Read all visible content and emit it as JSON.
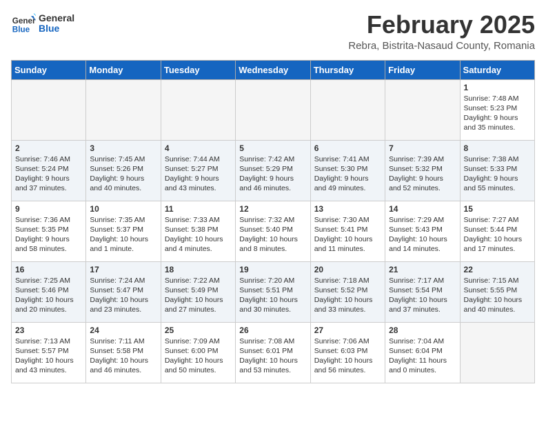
{
  "logo": {
    "text_general": "General",
    "text_blue": "Blue"
  },
  "header": {
    "month": "February 2025",
    "location": "Rebra, Bistrita-Nasaud County, Romania"
  },
  "weekdays": [
    "Sunday",
    "Monday",
    "Tuesday",
    "Wednesday",
    "Thursday",
    "Friday",
    "Saturday"
  ],
  "weeks": [
    [
      {
        "day": "",
        "info": ""
      },
      {
        "day": "",
        "info": ""
      },
      {
        "day": "",
        "info": ""
      },
      {
        "day": "",
        "info": ""
      },
      {
        "day": "",
        "info": ""
      },
      {
        "day": "",
        "info": ""
      },
      {
        "day": "1",
        "info": "Sunrise: 7:48 AM\nSunset: 5:23 PM\nDaylight: 9 hours and 35 minutes."
      }
    ],
    [
      {
        "day": "2",
        "info": "Sunrise: 7:46 AM\nSunset: 5:24 PM\nDaylight: 9 hours and 37 minutes."
      },
      {
        "day": "3",
        "info": "Sunrise: 7:45 AM\nSunset: 5:26 PM\nDaylight: 9 hours and 40 minutes."
      },
      {
        "day": "4",
        "info": "Sunrise: 7:44 AM\nSunset: 5:27 PM\nDaylight: 9 hours and 43 minutes."
      },
      {
        "day": "5",
        "info": "Sunrise: 7:42 AM\nSunset: 5:29 PM\nDaylight: 9 hours and 46 minutes."
      },
      {
        "day": "6",
        "info": "Sunrise: 7:41 AM\nSunset: 5:30 PM\nDaylight: 9 hours and 49 minutes."
      },
      {
        "day": "7",
        "info": "Sunrise: 7:39 AM\nSunset: 5:32 PM\nDaylight: 9 hours and 52 minutes."
      },
      {
        "day": "8",
        "info": "Sunrise: 7:38 AM\nSunset: 5:33 PM\nDaylight: 9 hours and 55 minutes."
      }
    ],
    [
      {
        "day": "9",
        "info": "Sunrise: 7:36 AM\nSunset: 5:35 PM\nDaylight: 9 hours and 58 minutes."
      },
      {
        "day": "10",
        "info": "Sunrise: 7:35 AM\nSunset: 5:37 PM\nDaylight: 10 hours and 1 minute."
      },
      {
        "day": "11",
        "info": "Sunrise: 7:33 AM\nSunset: 5:38 PM\nDaylight: 10 hours and 4 minutes."
      },
      {
        "day": "12",
        "info": "Sunrise: 7:32 AM\nSunset: 5:40 PM\nDaylight: 10 hours and 8 minutes."
      },
      {
        "day": "13",
        "info": "Sunrise: 7:30 AM\nSunset: 5:41 PM\nDaylight: 10 hours and 11 minutes."
      },
      {
        "day": "14",
        "info": "Sunrise: 7:29 AM\nSunset: 5:43 PM\nDaylight: 10 hours and 14 minutes."
      },
      {
        "day": "15",
        "info": "Sunrise: 7:27 AM\nSunset: 5:44 PM\nDaylight: 10 hours and 17 minutes."
      }
    ],
    [
      {
        "day": "16",
        "info": "Sunrise: 7:25 AM\nSunset: 5:46 PM\nDaylight: 10 hours and 20 minutes."
      },
      {
        "day": "17",
        "info": "Sunrise: 7:24 AM\nSunset: 5:47 PM\nDaylight: 10 hours and 23 minutes."
      },
      {
        "day": "18",
        "info": "Sunrise: 7:22 AM\nSunset: 5:49 PM\nDaylight: 10 hours and 27 minutes."
      },
      {
        "day": "19",
        "info": "Sunrise: 7:20 AM\nSunset: 5:51 PM\nDaylight: 10 hours and 30 minutes."
      },
      {
        "day": "20",
        "info": "Sunrise: 7:18 AM\nSunset: 5:52 PM\nDaylight: 10 hours and 33 minutes."
      },
      {
        "day": "21",
        "info": "Sunrise: 7:17 AM\nSunset: 5:54 PM\nDaylight: 10 hours and 37 minutes."
      },
      {
        "day": "22",
        "info": "Sunrise: 7:15 AM\nSunset: 5:55 PM\nDaylight: 10 hours and 40 minutes."
      }
    ],
    [
      {
        "day": "23",
        "info": "Sunrise: 7:13 AM\nSunset: 5:57 PM\nDaylight: 10 hours and 43 minutes."
      },
      {
        "day": "24",
        "info": "Sunrise: 7:11 AM\nSunset: 5:58 PM\nDaylight: 10 hours and 46 minutes."
      },
      {
        "day": "25",
        "info": "Sunrise: 7:09 AM\nSunset: 6:00 PM\nDaylight: 10 hours and 50 minutes."
      },
      {
        "day": "26",
        "info": "Sunrise: 7:08 AM\nSunset: 6:01 PM\nDaylight: 10 hours and 53 minutes."
      },
      {
        "day": "27",
        "info": "Sunrise: 7:06 AM\nSunset: 6:03 PM\nDaylight: 10 hours and 56 minutes."
      },
      {
        "day": "28",
        "info": "Sunrise: 7:04 AM\nSunset: 6:04 PM\nDaylight: 11 hours and 0 minutes."
      },
      {
        "day": "",
        "info": ""
      }
    ]
  ]
}
